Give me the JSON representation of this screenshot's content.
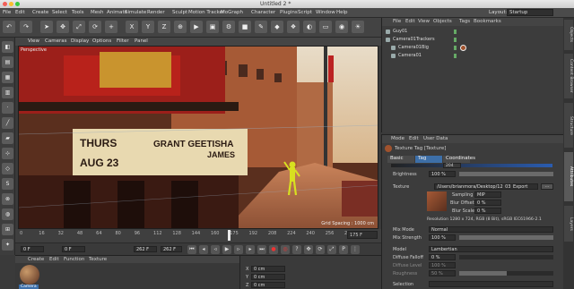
{
  "window": {
    "title": "Untitled 2 *",
    "layout_label": "Layout:",
    "layout_value": "Startup"
  },
  "menu": [
    "File",
    "Edit",
    "Create",
    "Select",
    "Tools",
    "Mesh",
    "Animate",
    "Simulate",
    "Render",
    "Sculpt",
    "Motion Tracker",
    "MoGraph",
    "Character",
    "Plugins",
    "Script",
    "Window",
    "Help"
  ],
  "viewport": {
    "menu": [
      "View",
      "Cameras",
      "Display",
      "Options",
      "Filter",
      "Panel"
    ],
    "label": "Perspective",
    "grid_spacing": "Grid Spacing : 1000 cm",
    "sign_line1": "THURS",
    "sign_line2": "AUG 23",
    "sign_name": "GRANT GEETISHA",
    "sign_name2": "JAMES"
  },
  "timeline": {
    "ticks": [
      "0",
      "16",
      "32",
      "48",
      "64",
      "80",
      "96",
      "112",
      "128",
      "144",
      "160",
      "175",
      "192",
      "208",
      "224",
      "240",
      "256",
      "272"
    ],
    "current": "175",
    "current_field": "175 F",
    "start_field": "0 F",
    "min_field": "0 F",
    "max_field": "262 F",
    "end_field": "262 F",
    "playhead_fraction": 0.64
  },
  "material_panel": {
    "menu": [
      "Create",
      "Edit",
      "Function",
      "Texture"
    ],
    "material_name": "Camera"
  },
  "coords": {
    "x1": "X",
    "y1": "Y",
    "z1": "Z",
    "v1": "0 cm",
    "v2": "0 cm",
    "v3": "0 cm"
  },
  "objects": {
    "menu": [
      "File",
      "Edit",
      "View",
      "Objects",
      "Tags",
      "Bookmarks"
    ],
    "items": [
      {
        "name": "Guy01",
        "indent": 0
      },
      {
        "name": "Camera01Trackers",
        "indent": 0
      },
      {
        "name": "Camera01Big",
        "indent": 1
      },
      {
        "name": "Camera01",
        "indent": 1
      }
    ]
  },
  "attributes": {
    "menu": [
      "Mode",
      "Edit",
      "User Data"
    ],
    "title": "Texture Tag [Texture]",
    "tabs": [
      "Basic",
      "Tag",
      "Coordinates"
    ],
    "active_tab": "Tag",
    "frame_value": "204",
    "brightness_label": "Brightness",
    "brightness_value": "100 %",
    "texture_label": "Texture",
    "texture_path": "/Users/brianmora/Desktop/12_03_Export",
    "sampling_label": "Sampling",
    "sampling_value": "MIP",
    "blur_offset_label": "Blur Offset",
    "blur_offset_value": "0 %",
    "blur_scale_label": "Blur Scale",
    "blur_scale_value": "0 %",
    "resolution": "Resolution 1280 x 724, RGB (8 Bit), sRGB IEC61966-2.1",
    "mix_mode_label": "Mix Mode",
    "mix_mode_value": "Normal",
    "mix_strength_label": "Mix Strength",
    "mix_strength_value": "100 %",
    "mix_strength_fraction": 1.0,
    "model_label": "Model",
    "model_value": "Lambertian",
    "diffuse_falloff_label": "Diffuse Falloff",
    "diffuse_falloff_value": "0 %",
    "diffuse_level_label": "Diffuse Level",
    "diffuse_level_value": "100 %",
    "roughness_label": "Roughness",
    "roughness_value": "50 %",
    "selection_label": "Selection"
  },
  "right_tabs": [
    "Objects",
    "Content Browser",
    "Structure",
    "Attributes",
    "Layers"
  ],
  "colors": {
    "accent_tab": "#3d6fa8",
    "figure": "#d8e020",
    "marquee": "#b8221b"
  }
}
